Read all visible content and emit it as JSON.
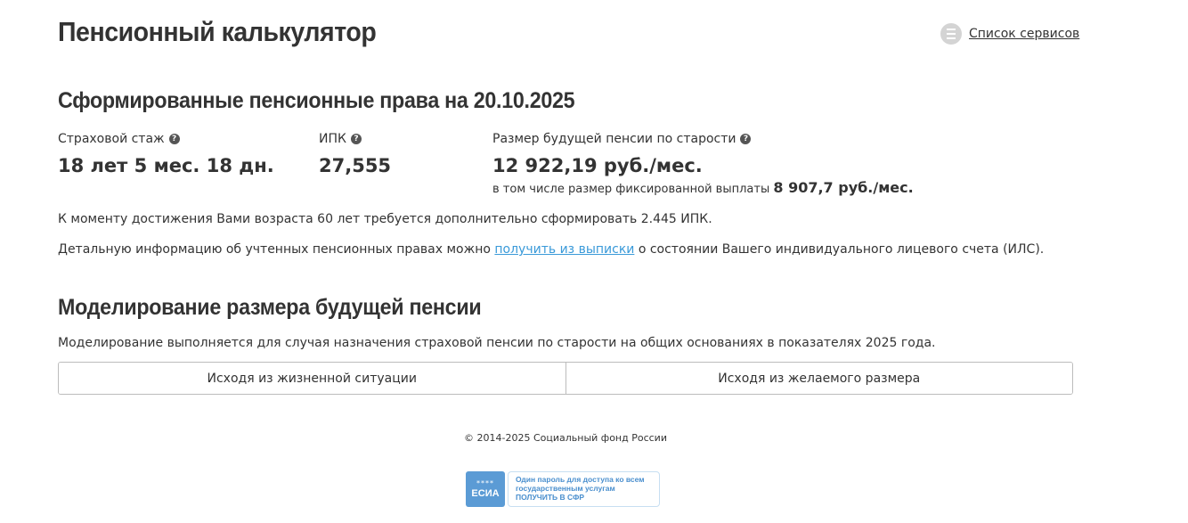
{
  "header": {
    "title": "Пенсионный калькулятор",
    "services_icon": "list-icon",
    "services_label": "Список сервисов"
  },
  "rights": {
    "title": "Сформированные пенсионные права на 20.10.2025",
    "stats": [
      {
        "label": "Страховой стаж",
        "value": "18 лет 5 мес. 18 дн."
      },
      {
        "label": "ИПК",
        "value": "27,555"
      },
      {
        "label": "Размер будущей пенсии по старости",
        "value": "12 922,19 руб./мес."
      }
    ],
    "fixed_note_prefix": "в том числе размер фиксированной выплаты",
    "fixed_note_value": "8 907,7 руб./мес.",
    "requirement_text": "К моменту достижения Вами возраста 60 лет требуется дополнительно сформировать 2.445 ИПК.",
    "details_prefix": "Детальную информацию об учтенных пенсионных правах можно ",
    "details_link": "получить из выписки",
    "details_suffix": " о состоянии Вашего индивидуального лицевого счета (ИЛС).",
    "help_icon": "?"
  },
  "modeling": {
    "title": "Моделирование размера будущей пенсии",
    "description": "Моделирование выполняется для случая назначения страховой пенсии по старости на общих основаниях в показателях 2025 года.",
    "tabs": [
      {
        "label": "Исходя из жизненной ситуации"
      },
      {
        "label": "Исходя из желаемого размера"
      }
    ]
  },
  "footer": {
    "copyright": "© 2014-2025 Социальный фонд России",
    "esia": {
      "stars": "****",
      "name": "ЕСИА",
      "line1": "Один пароль для доступа ко всем",
      "line2": "государственным услугам",
      "line3": "ПОЛУЧИТЬ В СФР"
    }
  },
  "colors": {
    "text": "#333333",
    "link": "#3a9ad9",
    "border": "#bcbcbc",
    "esia_blue": "#5b9bd5"
  }
}
